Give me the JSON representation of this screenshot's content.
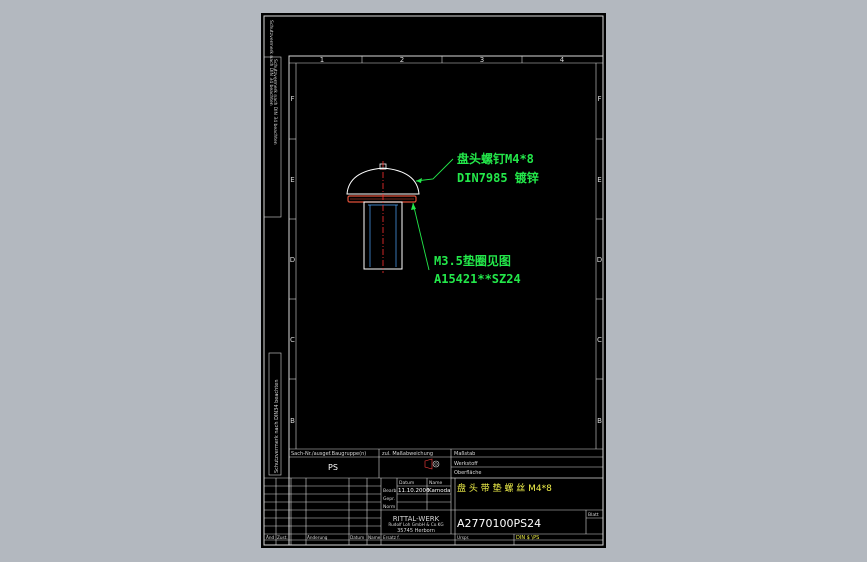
{
  "border": {
    "columns": [
      "1",
      "2",
      "3",
      "4"
    ],
    "rows": [
      "F",
      "E",
      "D",
      "C",
      "B"
    ]
  },
  "side_text": {
    "top_note": "Schutzvermerk nach DIN 34 beachten",
    "left_note": "Schutzvermerk nach DIN34 beachten"
  },
  "annotations": {
    "screw_line1": "盘头螺钉M4*8",
    "screw_line2": "DIN7985 镀锌",
    "washer_line1": "M3.5垫圈见图",
    "washer_line2": "A15421**SZ24"
  },
  "title_block": {
    "group_label": "Sach-Nr./ausgef.Baugruppe(n)",
    "group_value": "PS",
    "projection_label": "zul. Maßabweichung",
    "weight_label": "Maßstab",
    "surface_label": "Werkstoff",
    "material_label": "Oberfläche",
    "date_label": "Datum",
    "name_label": "Name",
    "drawn_label": "Bearb.",
    "drawn_date": "11.10.2006",
    "drawn_name": "Kamoda",
    "checked_label": "Gepr.",
    "norm_label": "Norm",
    "part_name": "盘 头 带 垫 螺 丝 M4*8",
    "company": "RITTAL-WERK",
    "company_sub": "Rudolf Loh GmbH & Co.KG",
    "company_addr": "35745 Herborn",
    "drawing_number": "A2770100PS24",
    "sheet_label": "Blatt",
    "revision_labels": [
      "Änd",
      "Zust.",
      "Änderung",
      "Datum",
      "Name",
      "Ersatz f."
    ],
    "origin_label": "Urspr.",
    "scale_value": "DIN $ \\PS"
  },
  "colors": {
    "background": "#b3b8bf",
    "sheet": "#000000",
    "frame": "#d8d8d8",
    "outline": "#ffffff",
    "annotation": "#23e84a",
    "centerline": "#ff3030",
    "washer": "#e0503a",
    "shank": "#4fa8ff",
    "part_name": "#f2f24a"
  }
}
